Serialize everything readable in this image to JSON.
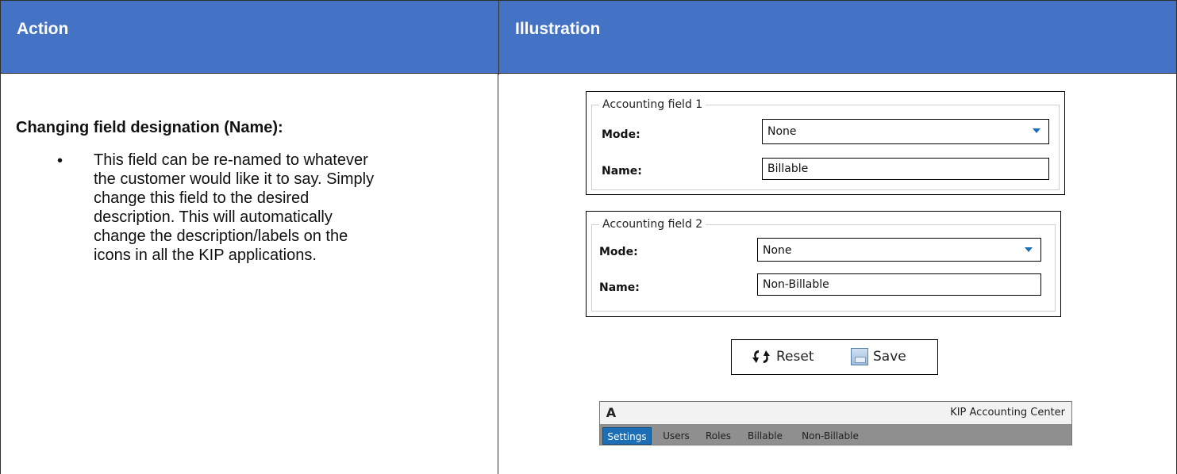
{
  "table": {
    "headers": {
      "action": "Action",
      "illustration": "Illustration"
    },
    "action": {
      "title": "Changing field designation (Name):",
      "bullet": "•",
      "lines": [
        "This field can be re-named to whatever",
        "the customer would like it to say. Simply",
        "change this field to the desired",
        "description. This will automatically",
        "change the description/labels on the",
        "icons in all the KIP applications."
      ]
    }
  },
  "illustration": {
    "field1": {
      "legend": "Accounting field 1",
      "mode_label": "Mode:",
      "mode_value": "None",
      "name_label": "Name:",
      "name_value": "Billable"
    },
    "field2": {
      "legend": "Accounting field 2",
      "mode_label": "Mode:",
      "mode_value": "None",
      "name_label": "Name:",
      "name_value": "Non-Billable"
    },
    "buttons": {
      "reset": "Reset",
      "save": "Save"
    },
    "app": {
      "logo": "A",
      "title": "KIP Accounting Center",
      "tabs": [
        "Settings",
        "Users",
        "Roles",
        "Billable",
        "Non-Billable"
      ],
      "active_tab": "Settings"
    }
  },
  "colors": {
    "header_bg": "#4472c4",
    "accent": "#1c6fb5"
  }
}
